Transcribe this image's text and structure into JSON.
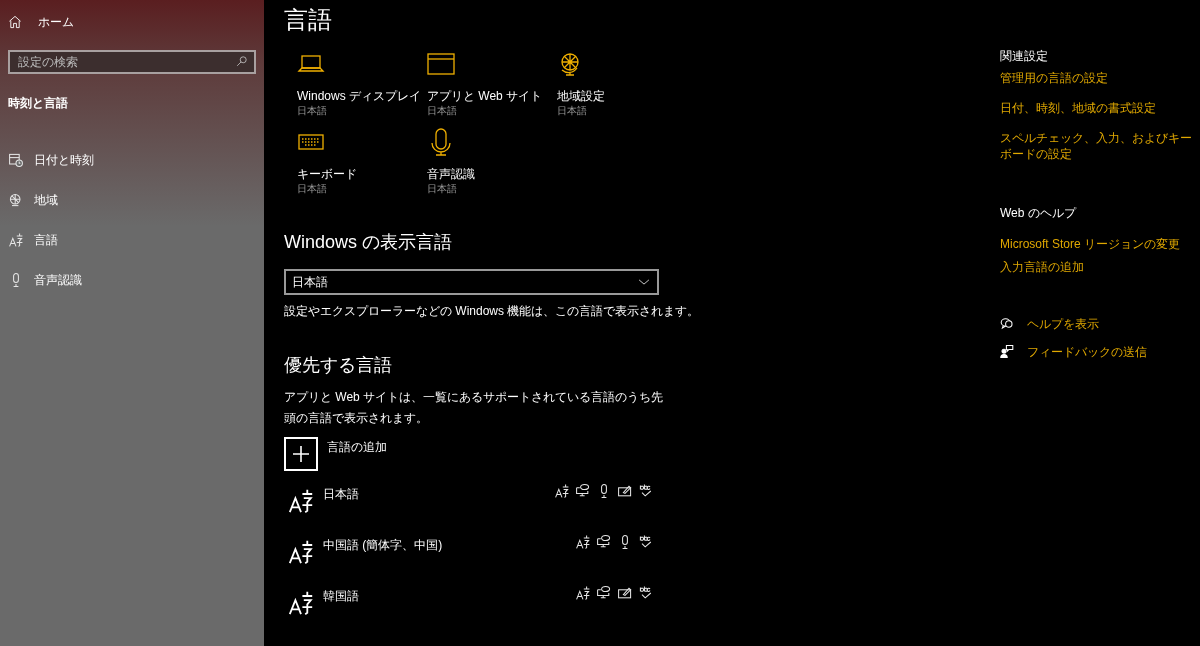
{
  "sidebar": {
    "home": "ホーム",
    "search": {
      "placeholder": "設定の検索"
    },
    "section": "時刻と言語",
    "items": [
      {
        "kind": "datetime",
        "label": "日付と時刻"
      },
      {
        "kind": "region",
        "label": "地域"
      },
      {
        "kind": "language",
        "label": "言語"
      },
      {
        "kind": "speech",
        "label": "音声認識"
      }
    ]
  },
  "page": {
    "title": "言語",
    "tiles": [
      {
        "kind": "display",
        "label": "Windows ディスプレイ",
        "value": "日本語"
      },
      {
        "kind": "apps",
        "label": "アプリと Web サイト",
        "value": "日本語"
      },
      {
        "kind": "region",
        "label": "地域設定",
        "value": "日本語"
      },
      {
        "kind": "keyboard",
        "label": "キーボード",
        "value": "日本語"
      },
      {
        "kind": "speech",
        "label": "音声認識",
        "value": "日本語"
      }
    ],
    "display_language": {
      "heading": "Windows の表示言語",
      "value": "日本語",
      "description": "設定やエクスプローラーなどの Windows 機能は、この言語で表示されます。"
    },
    "preferred": {
      "heading": "優先する言語",
      "description": "アプリと Web サイトは、一覧にあるサポートされている言語のうち先頭の言語で表示されます。",
      "add": "言語の追加",
      "languages": [
        {
          "name": "日本語",
          "features": [
            {
              "kind": "display"
            },
            {
              "kind": "tts"
            },
            {
              "kind": "speech"
            },
            {
              "kind": "handwriting"
            },
            {
              "kind": "spelling"
            }
          ]
        },
        {
          "name": "中国語 (簡体字、中国)",
          "features": [
            {
              "kind": "display"
            },
            {
              "kind": "tts"
            },
            {
              "kind": "speech"
            },
            {
              "kind": "spelling"
            }
          ]
        },
        {
          "name": "韓国語",
          "features": [
            {
              "kind": "display"
            },
            {
              "kind": "tts"
            },
            {
              "kind": "handwriting"
            },
            {
              "kind": "spelling"
            }
          ]
        }
      ]
    }
  },
  "related": {
    "heading": "関連設定",
    "links": [
      "管理用の言語の設定",
      "日付、時刻、地域の書式設定",
      "スペルチェック、入力、およびキーボードの設定"
    ],
    "web_help": {
      "heading": "Web のヘルプ",
      "links": [
        "Microsoft Store リージョンの変更",
        "入力言語の追加"
      ]
    },
    "actions": [
      {
        "kind": "help",
        "label": "ヘルプを表示"
      },
      {
        "kind": "feedback",
        "label": "フィードバックの送信"
      }
    ]
  }
}
